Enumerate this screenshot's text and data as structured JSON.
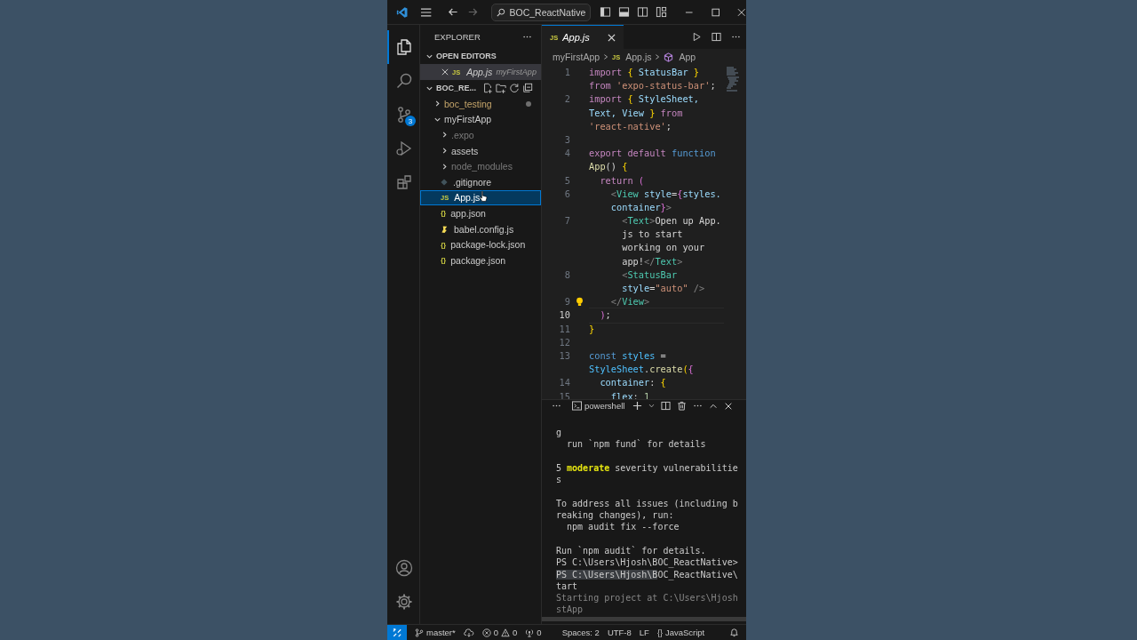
{
  "title_bar": {
    "command_center": "BOC_ReactNative"
  },
  "activity_bar": {
    "items": [
      {
        "kind": "explorer",
        "selected": true
      },
      {
        "kind": "search",
        "selected": false
      },
      {
        "kind": "source-control",
        "selected": false,
        "badge": "3"
      },
      {
        "kind": "run",
        "selected": false
      },
      {
        "kind": "extensions",
        "selected": false
      }
    ],
    "bottom": [
      {
        "kind": "account"
      },
      {
        "kind": "settings"
      }
    ]
  },
  "explorer": {
    "title": "EXPLORER",
    "open_editors": {
      "title": "OPEN EDITORS",
      "expanded": true,
      "items": [
        {
          "name": "App.js",
          "folder": "myFirstApp",
          "kind": "js",
          "icon": "JS"
        }
      ]
    },
    "workspace": {
      "title": "BOC_RE...",
      "expanded": true,
      "tree": [
        {
          "name": "boc_testing",
          "kind": "folder",
          "expanded": false,
          "modified": true,
          "ignored": false,
          "selected": false
        },
        {
          "name": "myFirstApp",
          "kind": "folder",
          "expanded": true,
          "modified": false,
          "ignored": false,
          "selected": false,
          "children": [
            {
              "name": ".expo",
              "kind": "folder",
              "expanded": false,
              "modified": false,
              "ignored": true,
              "selected": false
            },
            {
              "name": "assets",
              "kind": "folder",
              "expanded": false,
              "modified": false,
              "ignored": false,
              "selected": false
            },
            {
              "name": "node_modules",
              "kind": "folder",
              "expanded": false,
              "modified": false,
              "ignored": true,
              "selected": false
            },
            {
              "name": ".gitignore",
              "kind": "git",
              "modified": false,
              "ignored": false,
              "selected": false
            },
            {
              "name": "App.js",
              "kind": "js",
              "icon": "JS",
              "modified": false,
              "ignored": false,
              "selected": true
            },
            {
              "name": "app.json",
              "kind": "json",
              "icon": "{}",
              "modified": false,
              "ignored": false,
              "selected": false
            },
            {
              "name": "babel.config.js",
              "kind": "babel",
              "modified": false,
              "ignored": false,
              "selected": false
            },
            {
              "name": "package-lock.json",
              "kind": "json",
              "icon": "{}",
              "modified": false,
              "ignored": false,
              "selected": false
            },
            {
              "name": "package.json",
              "kind": "json",
              "icon": "{}",
              "modified": false,
              "ignored": false,
              "selected": false
            }
          ]
        }
      ]
    }
  },
  "editor": {
    "tabs": [
      {
        "label": "App.js",
        "kind": "js",
        "icon": "JS",
        "selected": true,
        "preview": true
      }
    ],
    "breadcrumbs": [
      {
        "text": "myFirstApp",
        "kind": "folder"
      },
      {
        "text": "App.js",
        "kind": "js",
        "icon": "JS"
      },
      {
        "text": "App",
        "kind": "symbol"
      }
    ],
    "lines": [
      {
        "number": "1",
        "current": false,
        "lightbulb": false,
        "rows": [
          {
            "tokens": [
              {
                "text": "import ",
                "kind": "keyword"
              },
              {
                "text": "{",
                "kind": "brace"
              },
              {
                "text": " StatusBar ",
                "kind": "name"
              },
              {
                "text": "}",
                "kind": "brace"
              }
            ]
          },
          {
            "tokens": [
              {
                "text": "from ",
                "kind": "keyword"
              },
              {
                "text": "'expo-status-bar'",
                "kind": "string"
              },
              {
                "text": ";",
                "kind": "plain"
              }
            ]
          }
        ]
      },
      {
        "number": "2",
        "current": false,
        "lightbulb": false,
        "rows": [
          {
            "tokens": [
              {
                "text": "import ",
                "kind": "keyword"
              },
              {
                "text": "{",
                "kind": "brace"
              },
              {
                "text": " StyleSheet,",
                "kind": "name"
              }
            ]
          },
          {
            "tokens": [
              {
                "text": "Text, View ",
                "kind": "name"
              },
              {
                "text": "}",
                "kind": "brace"
              },
              {
                "text": " from",
                "kind": "keyword"
              }
            ]
          },
          {
            "tokens": [
              {
                "text": "'react-native'",
                "kind": "string"
              },
              {
                "text": ";",
                "kind": "plain"
              }
            ]
          }
        ]
      },
      {
        "number": "3",
        "current": false,
        "lightbulb": false
      },
      {
        "number": "4",
        "current": false,
        "lightbulb": false,
        "rows": [
          {
            "tokens": [
              {
                "text": "export default ",
                "kind": "keyword"
              },
              {
                "text": "function",
                "kind": "storage"
              }
            ]
          },
          {
            "tokens": [
              {
                "text": "App",
                "kind": "function"
              },
              {
                "text": "() ",
                "kind": "plain"
              },
              {
                "text": "{",
                "kind": "brace"
              }
            ]
          }
        ]
      },
      {
        "number": "5",
        "current": false,
        "lightbulb": false,
        "rows": [
          {
            "tokens": [
              {
                "text": "  return ",
                "kind": "keyword"
              },
              {
                "text": "(",
                "kind": "paren"
              }
            ]
          }
        ]
      },
      {
        "number": "6",
        "current": false,
        "lightbulb": false,
        "rows": [
          {
            "tokens": [
              {
                "text": "    <",
                "kind": "punct"
              },
              {
                "text": "View",
                "kind": "tag"
              },
              {
                "text": " style",
                "kind": "name"
              },
              {
                "text": "=",
                "kind": "plain"
              },
              {
                "text": "{",
                "kind": "paren"
              },
              {
                "text": "styles.",
                "kind": "name"
              }
            ]
          },
          {
            "tokens": [
              {
                "text": "    container",
                "kind": "name"
              },
              {
                "text": "}",
                "kind": "paren"
              },
              {
                "text": ">",
                "kind": "punct"
              }
            ]
          }
        ]
      },
      {
        "number": "7",
        "current": false,
        "lightbulb": false,
        "rows": [
          {
            "tokens": [
              {
                "text": "      <",
                "kind": "punct"
              },
              {
                "text": "Text",
                "kind": "tag"
              },
              {
                "text": ">",
                "kind": "punct"
              },
              {
                "text": "Open up App.",
                "kind": "plain"
              }
            ]
          },
          {
            "tokens": [
              {
                "text": "      js to start",
                "kind": "plain"
              }
            ]
          },
          {
            "tokens": [
              {
                "text": "      working on your",
                "kind": "plain"
              }
            ]
          },
          {
            "tokens": [
              {
                "text": "      app!",
                "kind": "plain"
              },
              {
                "text": "</",
                "kind": "punct"
              },
              {
                "text": "Text",
                "kind": "tag"
              },
              {
                "text": ">",
                "kind": "punct"
              }
            ]
          }
        ]
      },
      {
        "number": "8",
        "current": false,
        "lightbulb": false,
        "rows": [
          {
            "tokens": [
              {
                "text": "      <",
                "kind": "punct"
              },
              {
                "text": "StatusBar",
                "kind": "tag"
              }
            ]
          },
          {
            "tokens": [
              {
                "text": "      style",
                "kind": "name"
              },
              {
                "text": "=",
                "kind": "plain"
              },
              {
                "text": "\"auto\"",
                "kind": "string"
              },
              {
                "text": " />",
                "kind": "punct"
              }
            ]
          }
        ]
      },
      {
        "number": "9",
        "current": false,
        "lightbulb": true,
        "rows": [
          {
            "tokens": [
              {
                "text": "    </",
                "kind": "punct"
              },
              {
                "text": "View",
                "kind": "tag"
              },
              {
                "text": ">",
                "kind": "punct"
              }
            ]
          }
        ]
      },
      {
        "number": "10",
        "current": true,
        "lightbulb": false,
        "rows": [
          {
            "tokens": [
              {
                "text": "  )",
                "kind": "paren"
              },
              {
                "text": ";",
                "kind": "plain"
              }
            ]
          }
        ]
      },
      {
        "number": "11",
        "current": false,
        "lightbulb": false,
        "rows": [
          {
            "tokens": [
              {
                "text": "}",
                "kind": "brace"
              }
            ]
          }
        ]
      },
      {
        "number": "12",
        "current": false,
        "lightbulb": false
      },
      {
        "number": "13",
        "current": false,
        "lightbulb": false,
        "rows": [
          {
            "tokens": [
              {
                "text": "const",
                "kind": "storage"
              },
              {
                "text": " styles ",
                "kind": "const"
              },
              {
                "text": "=",
                "kind": "plain"
              }
            ]
          },
          {
            "tokens": [
              {
                "text": "StyleSheet",
                "kind": "const"
              },
              {
                "text": ".",
                "kind": "plain"
              },
              {
                "text": "create",
                "kind": "function"
              },
              {
                "text": "(",
                "kind": "brace"
              },
              {
                "text": "{",
                "kind": "paren"
              }
            ]
          }
        ]
      },
      {
        "number": "14",
        "current": false,
        "lightbulb": false,
        "rows": [
          {
            "tokens": [
              {
                "text": "  container",
                "kind": "name"
              },
              {
                "text": ": ",
                "kind": "plain"
              },
              {
                "text": "{",
                "kind": "brace"
              }
            ]
          }
        ]
      },
      {
        "number": "15",
        "current": false,
        "lightbulb": false,
        "rows": [
          {
            "tokens": [
              {
                "text": "    flex",
                "kind": "name"
              },
              {
                "text": ": ",
                "kind": "plain"
              },
              {
                "text": "1",
                "kind": "number"
              }
            ]
          }
        ]
      }
    ]
  },
  "panel": {
    "terminal_name": "powershell",
    "blocks": [
      [
        {
          "segments": [
            {
              "text": "g",
              "kind": "plain"
            }
          ]
        },
        {
          "segments": [
            {
              "text": "  run `npm fund` for details",
              "kind": "plain"
            }
          ]
        }
      ],
      [
        {
          "segments": [
            {
              "text": "5 ",
              "kind": "plain"
            },
            {
              "text": "moderate",
              "kind": "warning"
            },
            {
              "text": " severity vulnerabilitie",
              "kind": "plain"
            }
          ]
        },
        {
          "segments": [
            {
              "text": "s",
              "kind": "plain"
            }
          ]
        }
      ],
      [
        {
          "segments": [
            {
              "text": "To address all issues (including b",
              "kind": "plain"
            }
          ]
        },
        {
          "segments": [
            {
              "text": "reaking changes), run:",
              "kind": "plain"
            }
          ]
        },
        {
          "segments": [
            {
              "text": "  npm audit fix --force",
              "kind": "plain"
            }
          ]
        }
      ],
      [
        {
          "segments": [
            {
              "text": "Run `npm audit` for details.",
              "kind": "plain"
            }
          ]
        },
        {
          "segments": [
            {
              "text": "PS C:\\Users\\Hjosh\\BOC_ReactNative>",
              "kind": "plain"
            }
          ]
        },
        {
          "segments": [
            {
              "text": "PS C:\\Users\\Hjosh\\B",
              "kind": "selection"
            },
            {
              "text": "OC_ReactNative\\",
              "kind": "plain"
            }
          ]
        },
        {
          "segments": [
            {
              "text": "tart",
              "kind": "plain"
            }
          ]
        },
        {
          "segments": [
            {
              "text": "Starting project at C:\\Users\\Hjosh",
              "kind": "dim"
            }
          ]
        },
        {
          "segments": [
            {
              "text": "stApp",
              "kind": "dim"
            }
          ]
        }
      ]
    ]
  },
  "status_bar": {
    "items": [
      {
        "kind": "branch",
        "text": "master*"
      },
      {
        "kind": "sync"
      },
      {
        "kind": "problems",
        "errors": "0",
        "warnings": "0"
      },
      {
        "kind": "ports",
        "text": "0"
      },
      {
        "kind": "plain",
        "text": "Spaces: 2"
      },
      {
        "kind": "plain",
        "text": "UTF-8"
      },
      {
        "kind": "plain",
        "text": "LF"
      },
      {
        "kind": "language",
        "icon": "{}",
        "text": "JavaScript"
      },
      {
        "kind": "bell"
      }
    ]
  }
}
